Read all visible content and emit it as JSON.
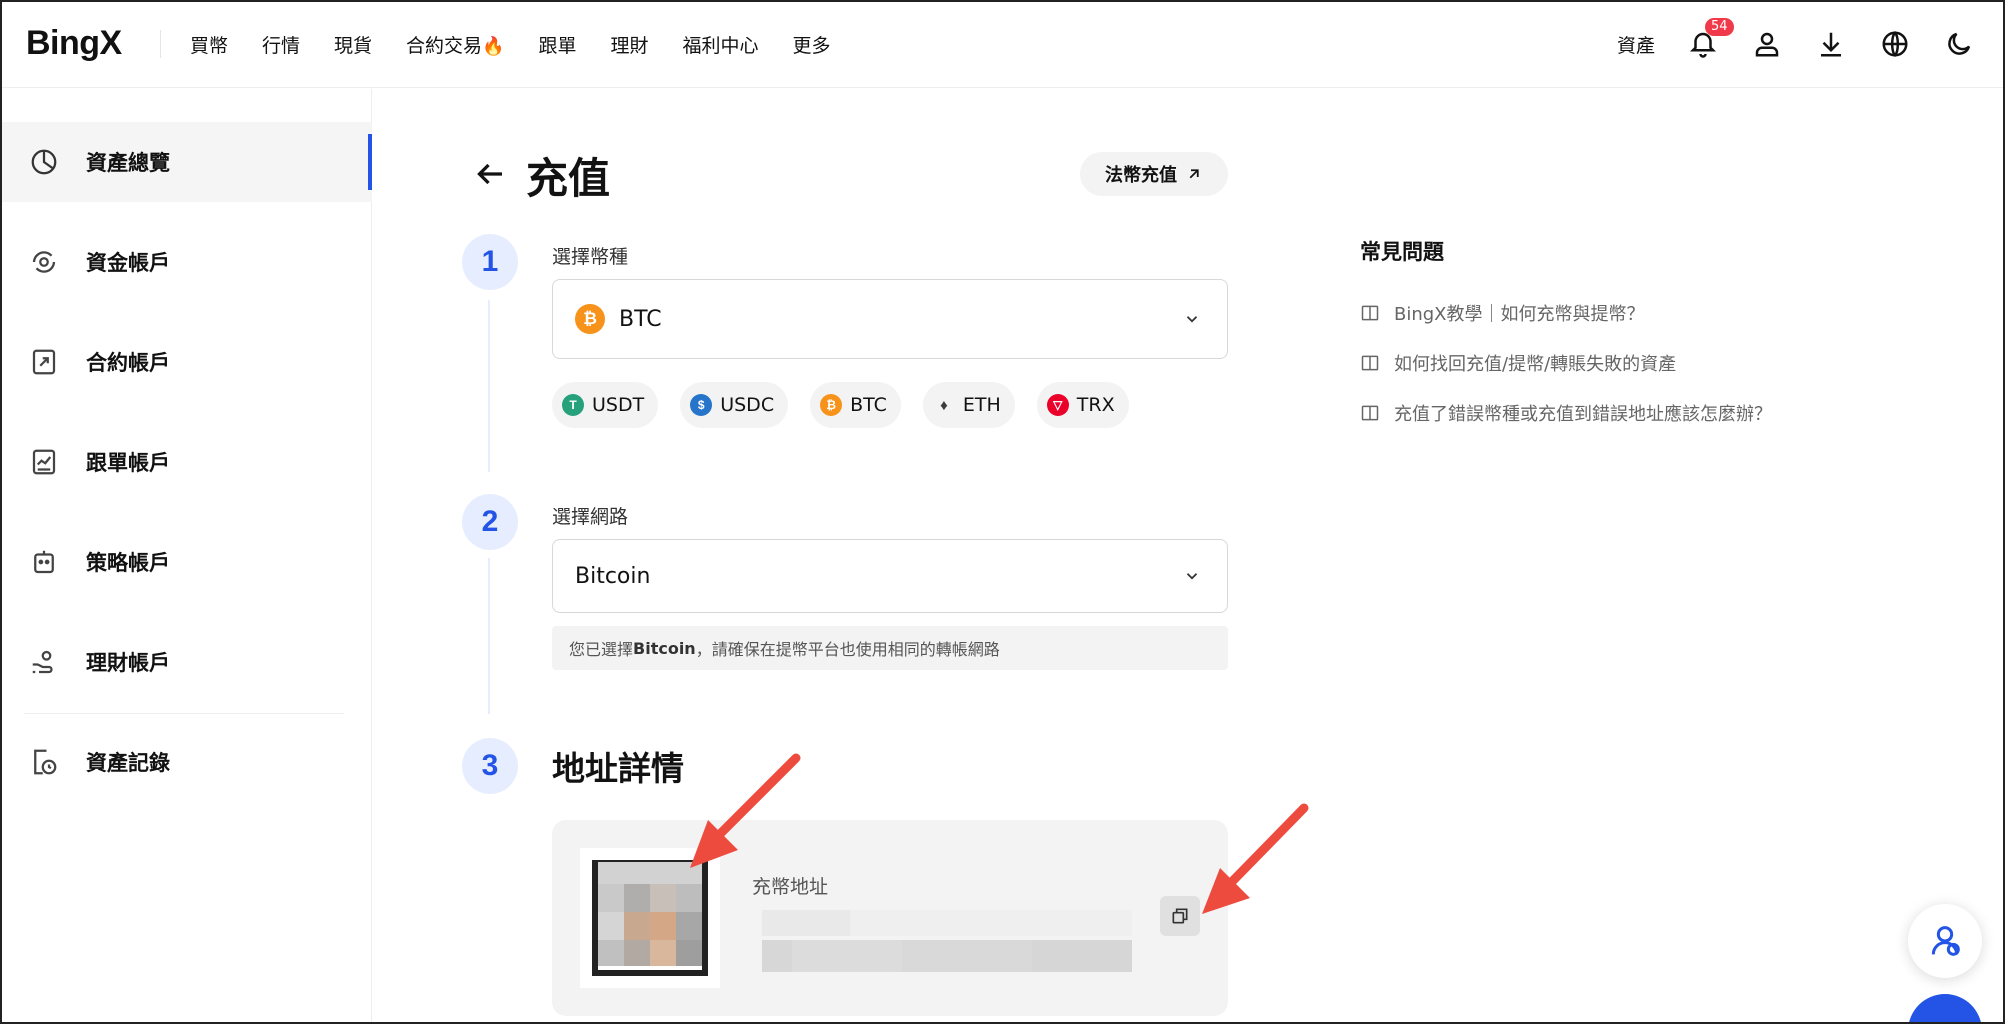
{
  "header": {
    "logo": "BingX",
    "nav": [
      "買幣",
      "行情",
      "現貨",
      "合約交易",
      "跟單",
      "理財",
      "福利中心",
      "更多"
    ],
    "assets": "資產",
    "notification_count": "54"
  },
  "sidebar": {
    "items": [
      {
        "label": "資產總覽",
        "icon": "pie-chart-icon",
        "active": true
      },
      {
        "label": "資金帳戶",
        "icon": "fund-account-icon"
      },
      {
        "label": "合約帳戶",
        "icon": "contract-account-icon"
      },
      {
        "label": "跟單帳戶",
        "icon": "copy-trade-account-icon"
      },
      {
        "label": "策略帳戶",
        "icon": "robot-icon"
      },
      {
        "label": "理財帳戶",
        "icon": "hand-coin-icon"
      },
      {
        "label": "資產記錄",
        "icon": "history-icon"
      }
    ]
  },
  "main": {
    "title": "充值",
    "fiat_button": "法幣充值",
    "steps": [
      {
        "num": "1",
        "label": "選擇幣種"
      },
      {
        "num": "2",
        "label": "選擇網路"
      },
      {
        "num": "3",
        "label": "地址詳情"
      }
    ],
    "coin_select": {
      "value": "BTC"
    },
    "quick_coins": [
      {
        "label": "USDT",
        "color": "#26a17b",
        "glyph": "T"
      },
      {
        "label": "USDC",
        "color": "#2775ca",
        "glyph": "$"
      },
      {
        "label": "BTC",
        "color": "#f7931a",
        "glyph": "₿"
      },
      {
        "label": "ETH",
        "color": "#3c3c3d",
        "glyph": "♦"
      },
      {
        "label": "TRX",
        "color": "#eb0029",
        "glyph": "▽"
      }
    ],
    "network_select": {
      "value": "Bitcoin"
    },
    "network_note": {
      "prefix": "您已選擇",
      "network": "Bitcoin",
      "suffix": "，請確保在提幣平台也使用相同的轉帳網路"
    },
    "address_label": "充幣地址"
  },
  "faq": {
    "title": "常見問題",
    "items": [
      "BingX教學｜如何充幣與提幣？",
      "如何找回充值/提幣/轉賬失敗的資產",
      "充值了錯誤幣種或充值到錯誤地址應該怎麼辦？"
    ]
  },
  "colors": {
    "accent": "#2354e6",
    "btc": "#f7931a",
    "badge": "#f0394a",
    "annotation_arrow": "#ee4b3f"
  }
}
